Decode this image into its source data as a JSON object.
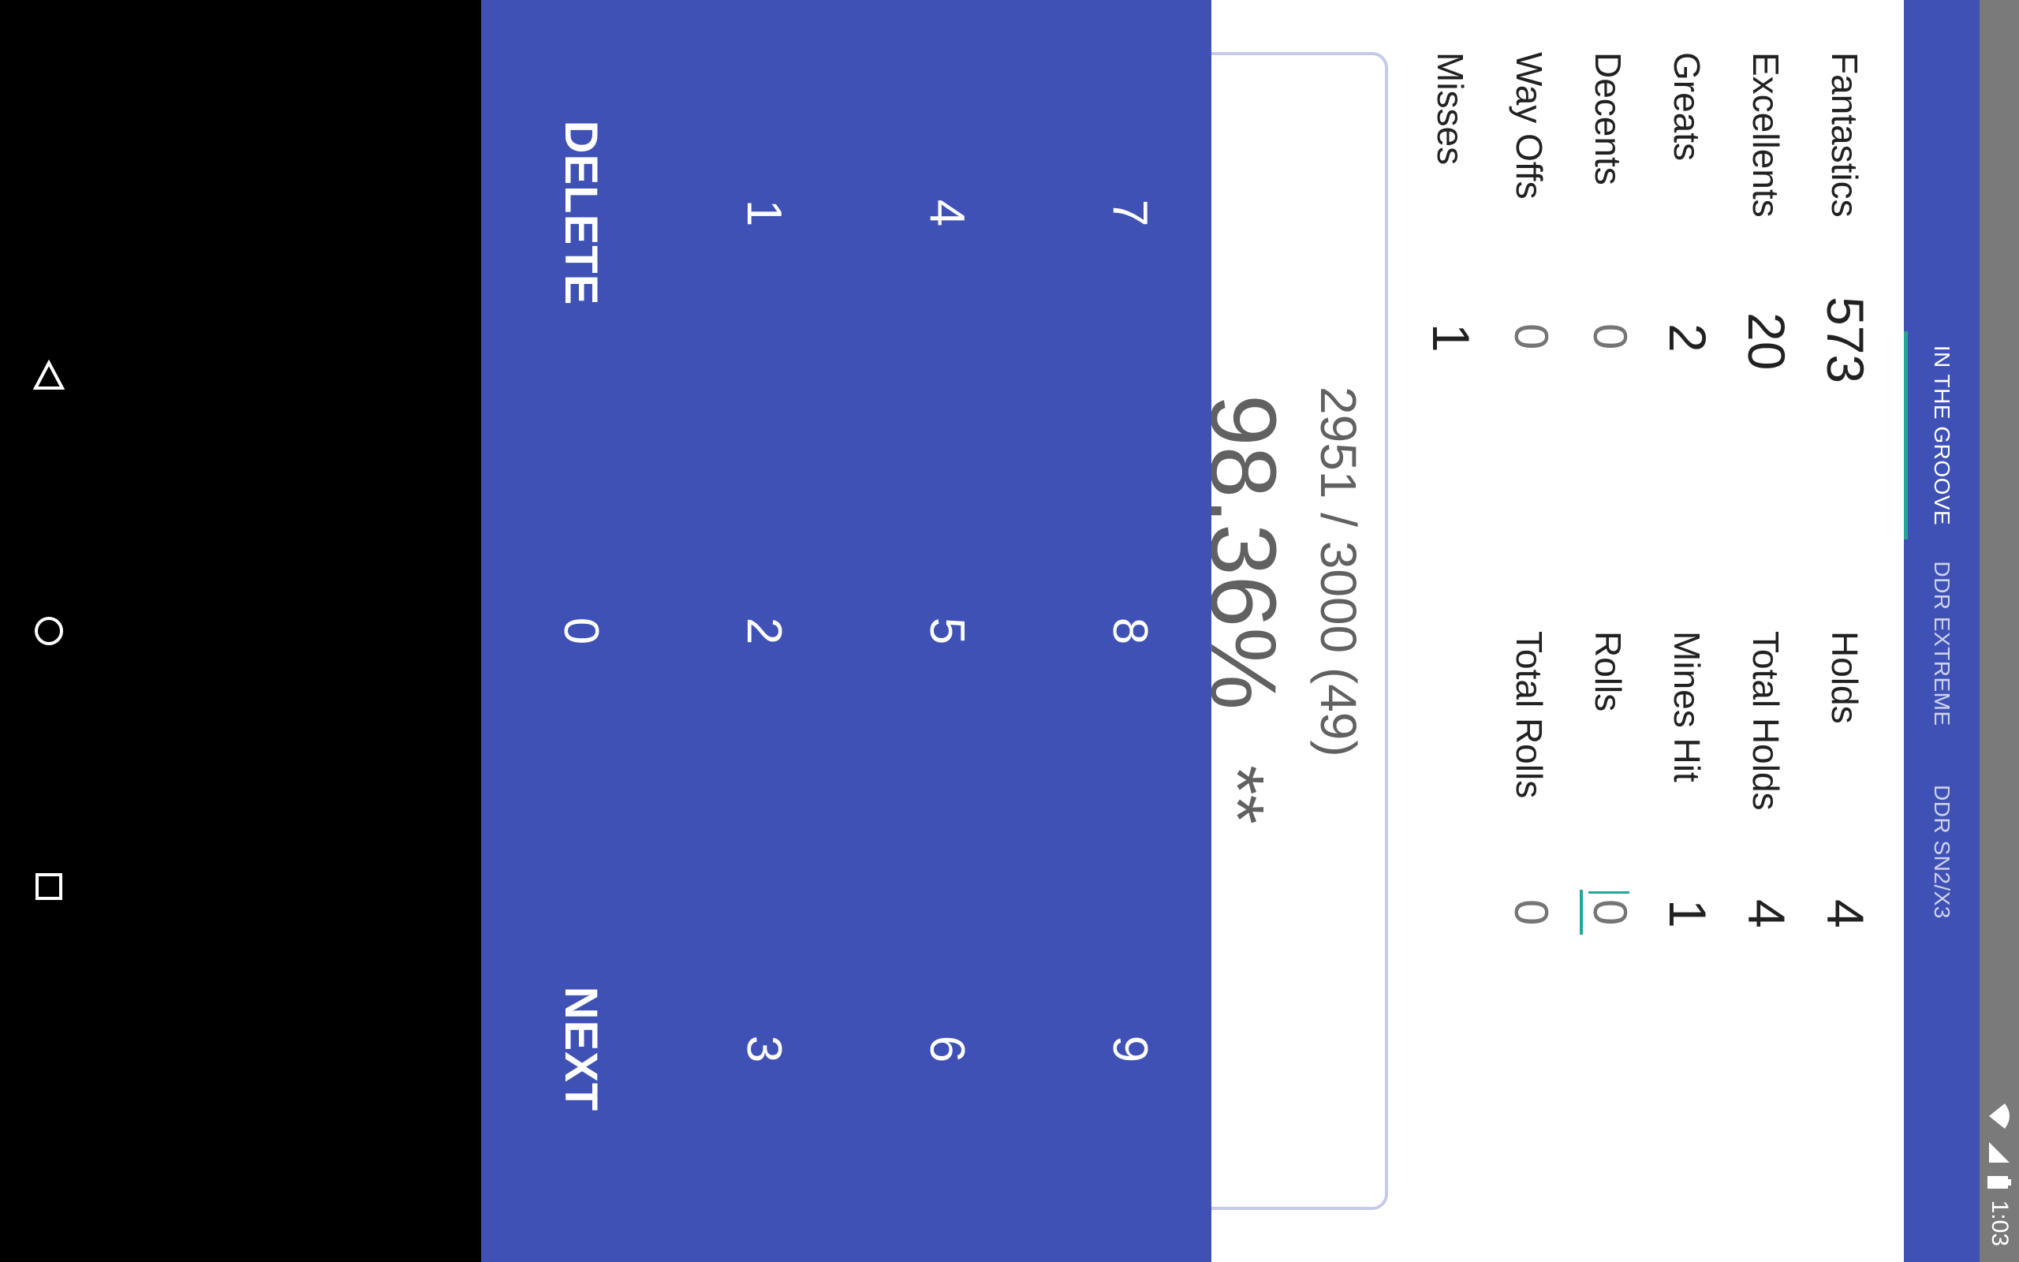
{
  "status": {
    "time": "1:03"
  },
  "tabs": [
    {
      "label": "IN THE GROOVE",
      "active": true
    },
    {
      "label": "DDR EXTREME",
      "active": false
    },
    {
      "label": "DDR SN2/X3",
      "active": false
    }
  ],
  "judgments": {
    "fantastics": {
      "label": "Fantastics",
      "value": "573"
    },
    "excellents": {
      "label": "Excellents",
      "value": "20"
    },
    "greats": {
      "label": "Greats",
      "value": "2"
    },
    "decents": {
      "label": "Decents",
      "value": "0"
    },
    "way_offs": {
      "label": "Way Offs",
      "value": "0"
    },
    "misses": {
      "label": "Misses",
      "value": "1"
    }
  },
  "holds": {
    "holds": {
      "label": "Holds",
      "value": "4"
    },
    "total_holds": {
      "label": "Total Holds",
      "value": "4"
    },
    "mines_hit": {
      "label": "Mines Hit",
      "value": "1"
    },
    "rolls": {
      "label": "Rolls",
      "value": "0"
    },
    "total_rolls": {
      "label": "Total Rolls",
      "value": "0"
    }
  },
  "result": {
    "score_line": "2951 / 3000 (49)",
    "percent": "98.36%",
    "grade": "**"
  },
  "keypad": {
    "k7": "7",
    "k8": "8",
    "k9": "9",
    "k4": "4",
    "k5": "5",
    "k6": "6",
    "k1": "1",
    "k2": "2",
    "k3": "3",
    "delete": "DELETE",
    "k0": "0",
    "next": "NEXT"
  },
  "colors": {
    "primary": "#3f51b5",
    "accent": "#26a69a",
    "status_bar": "#7a7a7a"
  },
  "icons": {
    "back": "back-icon",
    "home": "home-icon",
    "recents": "recents-icon",
    "wifi": "wifi-icon",
    "signal": "signal-icon",
    "battery": "battery-icon"
  }
}
